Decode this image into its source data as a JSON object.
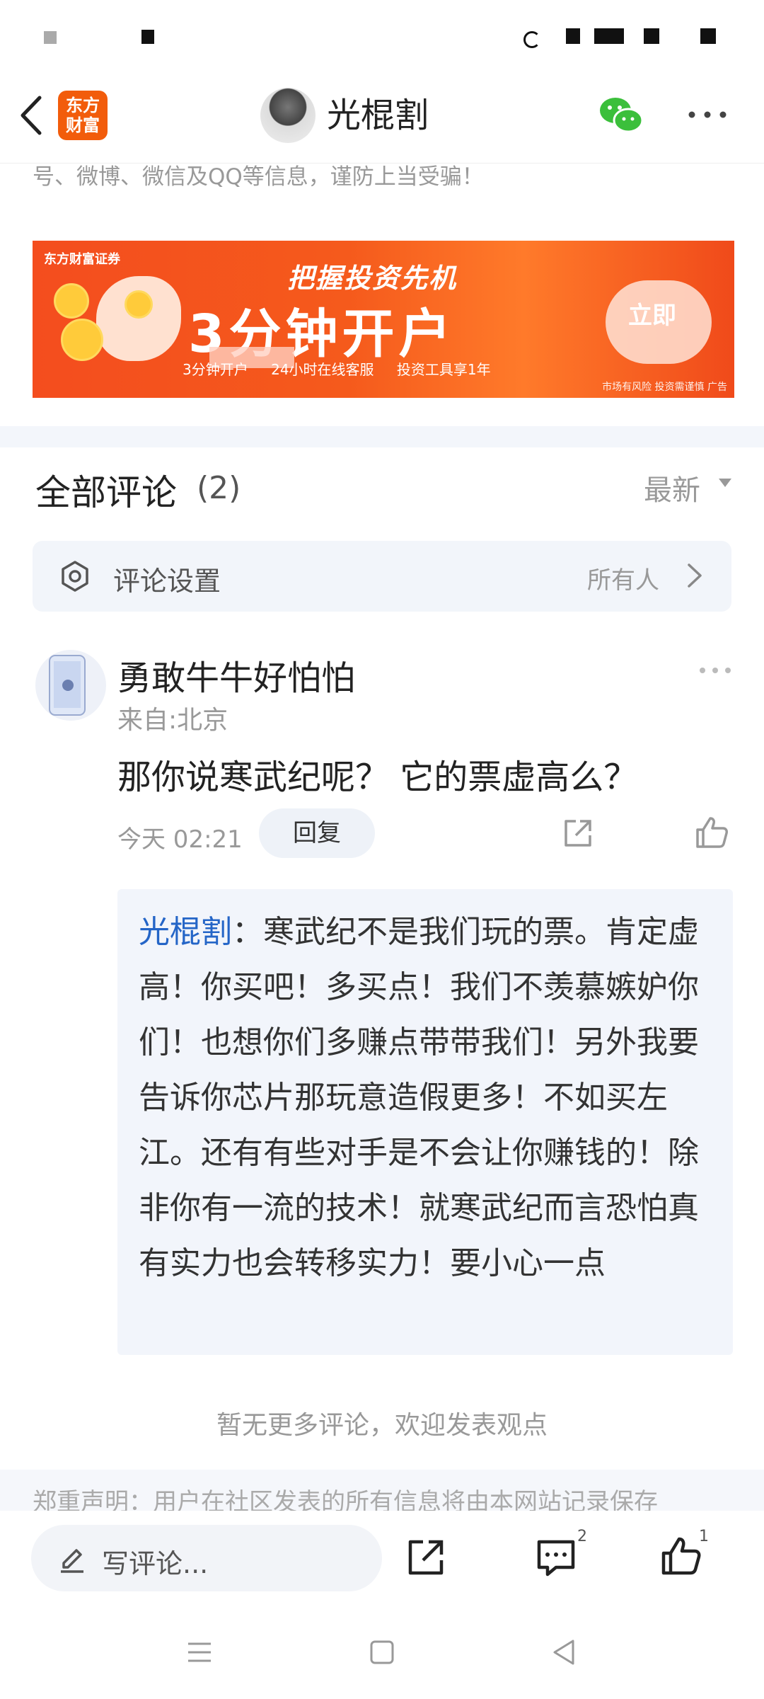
{
  "header": {
    "app_logo_line1": "东方",
    "app_logo_line2": "财富",
    "title": "光棍割"
  },
  "notice": "号、微博、微信及QQ等信息，谨防上当受骗！",
  "banner": {
    "brand": "东方财富证券",
    "headline": "把握投资先机",
    "big_text": "3分钟开户",
    "features": [
      "3分钟开户",
      "24小时在线客服",
      "投资工具享1年"
    ],
    "button": "立即",
    "risk": "市场有风险 投资需谨慎 广告"
  },
  "comments_section": {
    "title": "全部评论",
    "count": "(2)",
    "sort": "最新",
    "settings_label": "评论设置",
    "settings_value": "所有人"
  },
  "comment": {
    "author": "勇敢牛牛好怕怕",
    "location": "来自:北京",
    "text": "那你说寒武纪呢？ 它的票虚高么？",
    "time": "今天 02:21",
    "reply_label": "回复"
  },
  "reply": {
    "author": "光棍割",
    "text": "：寒武纪不是我们玩的票。肯定虚高！你买吧！多买点！我们不羡慕嫉妒你们！也想你们多赚点带带我们！另外我要告诉你芯片那玩意造假更多！不如买左江。还有有些对手是不会让你赚钱的！除非你有一流的技术！就寒武纪而言恐怕真有实力也会转移实力！要小心一点"
  },
  "no_more": "暂无更多评论，欢迎发表观点",
  "footer_text": "郑重声明：用户在社区发表的所有信息将由本网站记录保存",
  "bottom_bar": {
    "comment_placeholder": "写评论...",
    "comment_count": "2",
    "like_count": "1"
  },
  "colors": {
    "brand": "#f25c0b",
    "link": "#2465c7",
    "wechat": "#3bbf3b"
  }
}
